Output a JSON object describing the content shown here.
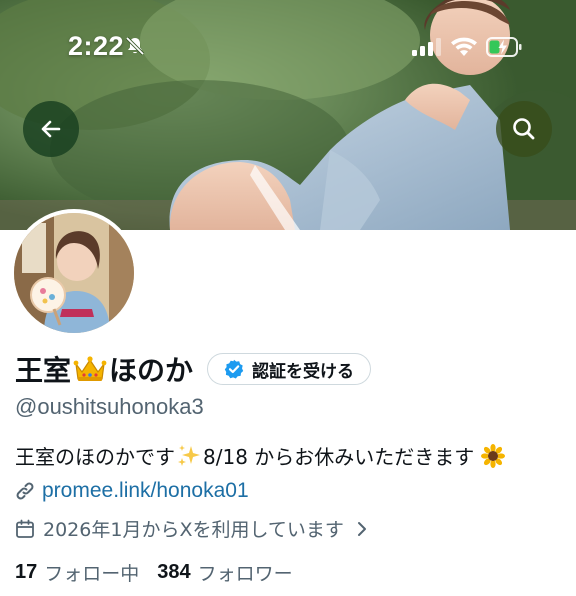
{
  "status_bar": {
    "time": "2:22"
  },
  "header": {
    "back_icon": "arrow-left-icon",
    "search_icon": "search-icon"
  },
  "profile": {
    "name_before": "王室",
    "name_emoji": "crown-icon",
    "name_after": "ほのか",
    "verify_button_label": "認証を受ける",
    "handle": "@oushitsuhonoka3",
    "bio_part1": "王室のほのかです",
    "bio_emoji1": "sparkles-icon",
    "bio_part2": "8/18 からお休みいただきます",
    "bio_emoji2": "sunflower-icon",
    "link": "promee.link/honoka01",
    "joined": "2026年1月からXを利用しています",
    "following_count": "17",
    "following_label": "フォロー中",
    "followers_count": "384",
    "followers_label": "フォロワー"
  },
  "colors": {
    "link": "#1d6fa5",
    "secondary_text": "#536471",
    "verified_blue": "#1d9bf0",
    "crown_gold": "#f5b400"
  }
}
